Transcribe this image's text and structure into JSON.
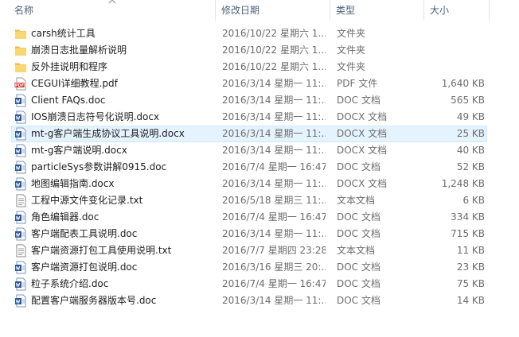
{
  "columns": {
    "name": "名称",
    "date": "修改日期",
    "type": "类型",
    "size": "大小"
  },
  "files": [
    {
      "name": "carsh统计工具",
      "date": "2016/10/22 星期六 1...",
      "type": "文件夹",
      "size": "",
      "icon": "folder-icon"
    },
    {
      "name": "崩溃日志批量解析说明",
      "date": "2016/10/22 星期六 1...",
      "type": "文件夹",
      "size": "",
      "icon": "folder-icon"
    },
    {
      "name": "反外挂说明和程序",
      "date": "2016/10/22 星期六 1...",
      "type": "文件夹",
      "size": "",
      "icon": "folder-icon"
    },
    {
      "name": "CEGUI详细教程.pdf",
      "date": "2016/3/14 星期一 11:...",
      "type": "PDF 文件",
      "size": "1,640 KB",
      "icon": "pdf-icon"
    },
    {
      "name": "Client FAQs.doc",
      "date": "2016/3/14 星期一 11:...",
      "type": "DOC 文档",
      "size": "565 KB",
      "icon": "word-doc-icon"
    },
    {
      "name": "IOS崩溃日志符号化说明.docx",
      "date": "2016/3/14 星期一 11:...",
      "type": "DOCX 文档",
      "size": "49 KB",
      "icon": "word-doc-icon"
    },
    {
      "name": "mt-g客户端生成协议工具说明.docx",
      "date": "2016/3/14 星期一 11:...",
      "type": "DOCX 文档",
      "size": "25 KB",
      "icon": "word-doc-icon",
      "highlighted": true
    },
    {
      "name": "mt-g客户端说明.docx",
      "date": "2016/3/14 星期一 11:...",
      "type": "DOCX 文档",
      "size": "40 KB",
      "icon": "word-doc-icon"
    },
    {
      "name": "particleSys参数讲解0915.doc",
      "date": "2016/7/4 星期一 16:47",
      "type": "DOC 文档",
      "size": "52 KB",
      "icon": "word-doc-icon"
    },
    {
      "name": "地图编辑指南.docx",
      "date": "2016/3/14 星期一 11:...",
      "type": "DOCX 文档",
      "size": "1,248 KB",
      "icon": "word-doc-icon"
    },
    {
      "name": "工程中源文件变化记录.txt",
      "date": "2016/5/18 星期三 11:...",
      "type": "文本文档",
      "size": "6 KB",
      "icon": "text-file-icon"
    },
    {
      "name": "角色编辑器.doc",
      "date": "2016/7/4 星期一 16:47",
      "type": "DOC 文档",
      "size": "334 KB",
      "icon": "word-doc-icon"
    },
    {
      "name": "客户端配表工具说明.doc",
      "date": "2016/3/14 星期一 11:...",
      "type": "DOC 文档",
      "size": "715 KB",
      "icon": "word-doc-icon"
    },
    {
      "name": "客户端资源打包工具使用说明.txt",
      "date": "2016/7/7 星期四 23:28",
      "type": "文本文档",
      "size": "11 KB",
      "icon": "text-file-icon"
    },
    {
      "name": "客户端资源打包说明.doc",
      "date": "2016/3/16 星期三 20:...",
      "type": "DOC 文档",
      "size": "23 KB",
      "icon": "word-doc-icon"
    },
    {
      "name": "粒子系统介绍.doc",
      "date": "2016/7/4 星期一 16:47",
      "type": "DOC 文档",
      "size": "75 KB",
      "icon": "word-doc-icon"
    },
    {
      "name": "配置客户端服务器版本号.doc",
      "date": "2016/3/14 星期一 11:...",
      "type": "DOC 文档",
      "size": "14 KB",
      "icon": "word-doc-icon"
    }
  ],
  "colors": {
    "folder": "#f8d775",
    "folder_dark": "#e8b84a",
    "pdf": "#d9332b",
    "word": "#2b579a",
    "highlight": "#e5f3ff"
  }
}
